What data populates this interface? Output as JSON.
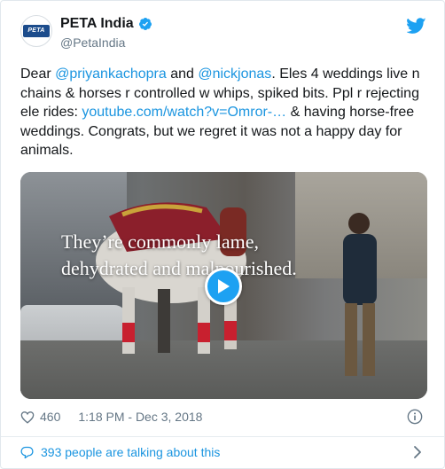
{
  "author": {
    "display_name": "PETA India",
    "handle": "@PetaIndia",
    "avatar_text": "PETA INDIA",
    "verified": true
  },
  "tweet": {
    "part1": "Dear ",
    "mention1": "@priyankachopra",
    "part2": " and ",
    "mention2": "@nickjonas",
    "part3": ". Eles 4 weddings live n chains & horses r controlled w whips, spiked bits. Ppl r rejecting ele rides: ",
    "url": "youtube.com/watch?v=Omror-…",
    "part4": " & having horse-free weddings. Congrats, but we regret it was not a happy day for animals."
  },
  "media": {
    "caption_line1": "They’re commonly lame,",
    "caption_line2": "dehydrated and malnourished.",
    "type": "video"
  },
  "meta": {
    "likes": "460",
    "timestamp": "1:18 PM - Dec 3, 2018"
  },
  "footer": {
    "talking": "393 people are talking about this"
  },
  "colors": {
    "link": "#1b95e0",
    "verified": "#1da1f2",
    "secondary_text": "#657786"
  },
  "icons": [
    "verified-badge-icon",
    "twitter-bird-icon",
    "play-icon",
    "heart-icon",
    "info-icon",
    "speech-bubble-icon",
    "chevron-right-icon"
  ]
}
